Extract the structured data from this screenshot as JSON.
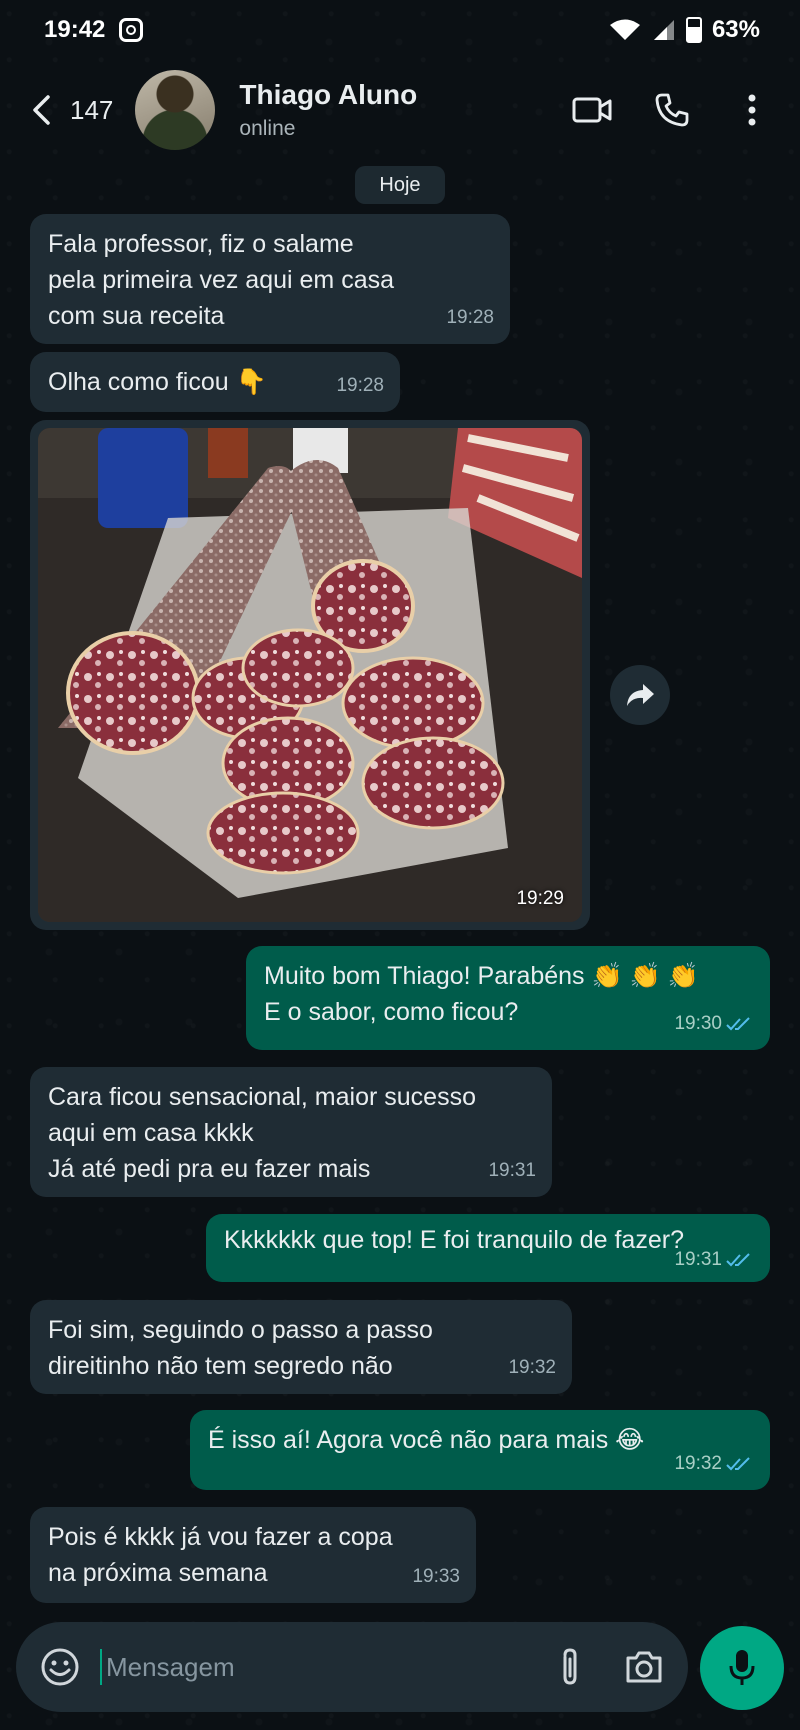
{
  "status_bar": {
    "time": "19:42",
    "battery": "63%"
  },
  "header": {
    "unread_count": "147",
    "contact_name": "Thiago Aluno",
    "contact_status": "online"
  },
  "date_chip": "Hoje",
  "messages": [
    {
      "direction": "in",
      "text": "Fala professor, fiz o salame\npela primeira vez aqui em casa\ncom sua receita",
      "time": "19:28"
    },
    {
      "direction": "in",
      "text": "Olha como ficou 👇",
      "time": "19:28"
    },
    {
      "direction": "in",
      "type": "image",
      "time": "19:29"
    },
    {
      "direction": "out",
      "text": "Muito bom Thiago! Parabéns 👏 👏 👏\nE o sabor, como ficou?",
      "time": "19:30"
    },
    {
      "direction": "in",
      "text": "Cara ficou sensacional, maior sucesso\naqui em casa kkkk\nJá até pedi pra eu fazer mais",
      "time": "19:31"
    },
    {
      "direction": "out",
      "text": "Kkkkkkk que top! E foi tranquilo de fazer?",
      "time": "19:31"
    },
    {
      "direction": "in",
      "text": "Foi sim, seguindo o passo a passo\ndireitinho não tem segredo não",
      "time": "19:32"
    },
    {
      "direction": "out",
      "text": "É isso aí! Agora você não para mais 😂",
      "time": "19:32"
    },
    {
      "direction": "in",
      "text": "Pois é kkkk já vou fazer a copa\nna próxima semana",
      "time": "19:33"
    }
  ],
  "input": {
    "placeholder": "Mensagem"
  },
  "colors": {
    "incoming": "#1f2c34",
    "outgoing": "#005c4b",
    "accent": "#00a884",
    "read_ticks": "#53bdeb"
  },
  "icons": [
    "instagram-icon",
    "wifi-icon",
    "signal-icon",
    "battery-icon",
    "back-icon",
    "video-call-icon",
    "voice-call-icon",
    "menu-icon",
    "forward-icon",
    "emoji-icon",
    "attach-icon",
    "camera-icon",
    "mic-icon"
  ]
}
